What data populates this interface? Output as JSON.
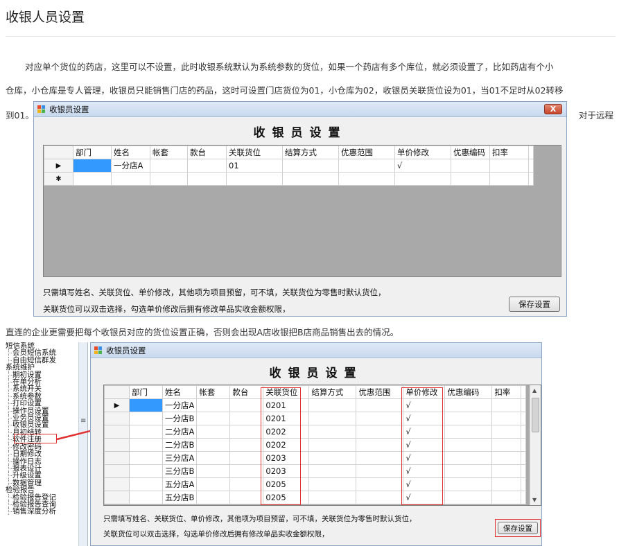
{
  "page_title": "收银人员设置",
  "para1_line1": "对应单个货位的药店，这里可以不设置，此时收银系统默认为系统参数的货位，如果一个药店有多个库位，就必须设置了，比如药店有个小",
  "para1_line2": "仓库，小仓库是专人管理，收银员只能销售门店的药品，这时可设置门店货位为01，小仓库为02，收银员关联货位设为01，当01不足时从02转移",
  "para1_line3a": "到01。",
  "para1_line3b": "对于远程",
  "para2": "直连的企业更需要把每个收银员对应的货位设置正确，否则会出现A店收银把B店商品销售出去的情况。",
  "window1": {
    "title": "收银员设置",
    "close_label": "X",
    "heading": "收银员设置",
    "columns": [
      "部门",
      "姓名",
      "帐套",
      "款台",
      "关联货位",
      "结算方式",
      "优惠范围",
      "单价修改",
      "优惠编码",
      "扣率"
    ],
    "rows": [
      {
        "marker": "▶",
        "cells": [
          "",
          "一分店A",
          "",
          "",
          "01",
          "",
          "",
          "√",
          "",
          ""
        ]
      },
      {
        "marker": "✱",
        "cells": [
          "",
          "",
          "",
          "",
          "",
          "",
          "",
          "",
          "",
          ""
        ]
      }
    ],
    "note1": "只需填写姓名、关联货位、单价修改，其他项为项目预留，可不填，关联货位为零售时默认货位，",
    "note2": "关联货位可以双击选择，勾选单价修改后拥有修改单品实收金额权限，",
    "save_label": "保存设置"
  },
  "tree": {
    "groups": [
      {
        "label": "短信系统",
        "items": [
          "会员短信系统",
          "自由短信群发"
        ]
      },
      {
        "label": "系统维护",
        "items": [
          "期初设置",
          "在单分析",
          "系统开关",
          "系统参数",
          "打印设置",
          "操作员设置",
          "业务员设置",
          "收银员设置",
          "月初结转",
          "软件注册",
          "修改密码",
          "日期修改",
          "操作日志",
          "报表设计",
          "升级设置",
          "数据管理"
        ]
      },
      {
        "label": "检验报告",
        "items": [
          "检验报告登记",
          "检验报告查询",
          "销售深度分析"
        ]
      }
    ],
    "splitter_glyph": "≡"
  },
  "window2": {
    "title": "收银员设置",
    "close_label": "X",
    "heading": "收银员设置",
    "columns": [
      "部门",
      "姓名",
      "帐套",
      "款台",
      "关联货位",
      "结算方式",
      "优惠范围",
      "单价修改",
      "优惠编码",
      "扣率"
    ],
    "rows": [
      {
        "marker": "▶",
        "cells": [
          "",
          "一分店A",
          "",
          "",
          "0201",
          "",
          "",
          "√",
          "",
          ""
        ]
      },
      {
        "marker": "",
        "cells": [
          "",
          "一分店B",
          "",
          "",
          "0201",
          "",
          "",
          "√",
          "",
          ""
        ]
      },
      {
        "marker": "",
        "cells": [
          "",
          "二分店A",
          "",
          "",
          "0202",
          "",
          "",
          "√",
          "",
          ""
        ]
      },
      {
        "marker": "",
        "cells": [
          "",
          "二分店B",
          "",
          "",
          "0202",
          "",
          "",
          "√",
          "",
          ""
        ]
      },
      {
        "marker": "",
        "cells": [
          "",
          "三分店A",
          "",
          "",
          "0203",
          "",
          "",
          "√",
          "",
          ""
        ]
      },
      {
        "marker": "",
        "cells": [
          "",
          "三分店B",
          "",
          "",
          "0203",
          "",
          "",
          "√",
          "",
          ""
        ]
      },
      {
        "marker": "",
        "cells": [
          "",
          "五分店A",
          "",
          "",
          "0205",
          "",
          "",
          "√",
          "",
          ""
        ]
      },
      {
        "marker": "",
        "cells": [
          "",
          "五分店B",
          "",
          "",
          "0205",
          "",
          "",
          "√",
          "",
          ""
        ]
      }
    ],
    "note1": "只需填写姓名、关联货位、单价修改，其他项为项目预留，可不填，关联货位为零售时默认货位，",
    "note2": "关联货位可以双击选择，勾选单价修改后拥有修改单品实收金额权限，",
    "save_label": "保存设置"
  },
  "colors": {
    "accent_red": "#e03030",
    "selection_blue": "#3399ff"
  }
}
